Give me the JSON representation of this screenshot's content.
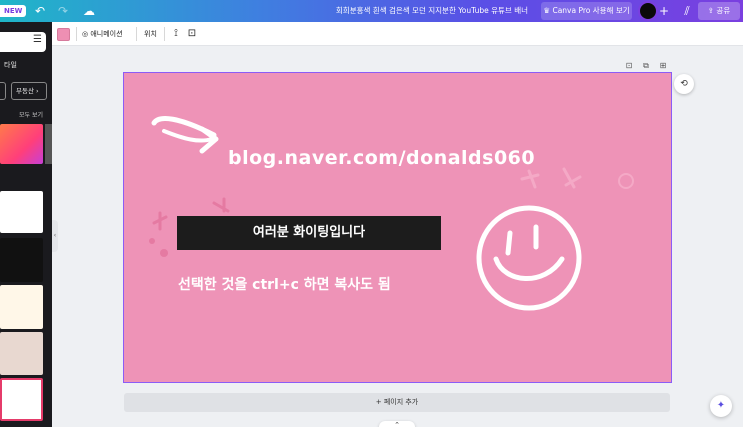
{
  "topbar": {
    "new_badge": "NEW",
    "undo_icon": "↶",
    "redo_icon": "↷",
    "cloud_icon": "☁",
    "title": "회희분홍색 흰색 검은색 모던 지지분한 YouTube 유튜브 배너",
    "pro_label": "♛ Canva Pro 사용해 보기",
    "plus_icon": "+",
    "stats_icon": "⫽",
    "share_label": "⇪ 공유"
  },
  "sidepanel": {
    "filter_icon": "☰",
    "section_label": "타일",
    "chip_label": "부동산 ›",
    "see_all": "모두 보기",
    "collapse_icon": "‹"
  },
  "toolbar": {
    "color": "#ee8fb3",
    "animate_label": "애니메이션",
    "position_label": "위치",
    "paint_icon": "⟟",
    "lock_icon": "⊡"
  },
  "page_actions": {
    "lock_icon": "⊡",
    "duplicate_icon": "⧉",
    "add_icon": "⊞"
  },
  "design": {
    "background": "#ee93b7",
    "url": "blog.naver.com/donalds060",
    "box_text": "여러분 화이팅입니다",
    "copy_text": "선택한 것을 ctrl+c 하면 복사도 됨"
  },
  "canvas": {
    "comment_icon": "⟲",
    "add_page_label": "+ 페이지 추가",
    "magic_icon": "✦",
    "scroll_icon": "⌃"
  }
}
